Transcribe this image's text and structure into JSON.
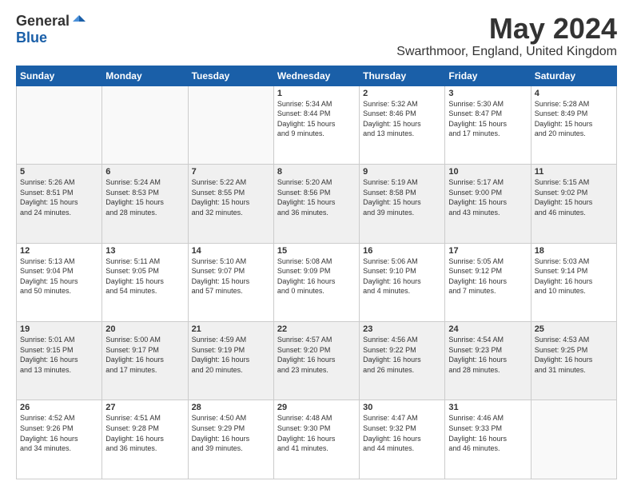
{
  "logo": {
    "general": "General",
    "blue": "Blue"
  },
  "header": {
    "month": "May 2024",
    "location": "Swarthmoor, England, United Kingdom"
  },
  "weekdays": [
    "Sunday",
    "Monday",
    "Tuesday",
    "Wednesday",
    "Thursday",
    "Friday",
    "Saturday"
  ],
  "weeks": [
    [
      {
        "day": "",
        "info": ""
      },
      {
        "day": "",
        "info": ""
      },
      {
        "day": "",
        "info": ""
      },
      {
        "day": "1",
        "info": "Sunrise: 5:34 AM\nSunset: 8:44 PM\nDaylight: 15 hours\nand 9 minutes."
      },
      {
        "day": "2",
        "info": "Sunrise: 5:32 AM\nSunset: 8:46 PM\nDaylight: 15 hours\nand 13 minutes."
      },
      {
        "day": "3",
        "info": "Sunrise: 5:30 AM\nSunset: 8:47 PM\nDaylight: 15 hours\nand 17 minutes."
      },
      {
        "day": "4",
        "info": "Sunrise: 5:28 AM\nSunset: 8:49 PM\nDaylight: 15 hours\nand 20 minutes."
      }
    ],
    [
      {
        "day": "5",
        "info": "Sunrise: 5:26 AM\nSunset: 8:51 PM\nDaylight: 15 hours\nand 24 minutes."
      },
      {
        "day": "6",
        "info": "Sunrise: 5:24 AM\nSunset: 8:53 PM\nDaylight: 15 hours\nand 28 minutes."
      },
      {
        "day": "7",
        "info": "Sunrise: 5:22 AM\nSunset: 8:55 PM\nDaylight: 15 hours\nand 32 minutes."
      },
      {
        "day": "8",
        "info": "Sunrise: 5:20 AM\nSunset: 8:56 PM\nDaylight: 15 hours\nand 36 minutes."
      },
      {
        "day": "9",
        "info": "Sunrise: 5:19 AM\nSunset: 8:58 PM\nDaylight: 15 hours\nand 39 minutes."
      },
      {
        "day": "10",
        "info": "Sunrise: 5:17 AM\nSunset: 9:00 PM\nDaylight: 15 hours\nand 43 minutes."
      },
      {
        "day": "11",
        "info": "Sunrise: 5:15 AM\nSunset: 9:02 PM\nDaylight: 15 hours\nand 46 minutes."
      }
    ],
    [
      {
        "day": "12",
        "info": "Sunrise: 5:13 AM\nSunset: 9:04 PM\nDaylight: 15 hours\nand 50 minutes."
      },
      {
        "day": "13",
        "info": "Sunrise: 5:11 AM\nSunset: 9:05 PM\nDaylight: 15 hours\nand 54 minutes."
      },
      {
        "day": "14",
        "info": "Sunrise: 5:10 AM\nSunset: 9:07 PM\nDaylight: 15 hours\nand 57 minutes."
      },
      {
        "day": "15",
        "info": "Sunrise: 5:08 AM\nSunset: 9:09 PM\nDaylight: 16 hours\nand 0 minutes."
      },
      {
        "day": "16",
        "info": "Sunrise: 5:06 AM\nSunset: 9:10 PM\nDaylight: 16 hours\nand 4 minutes."
      },
      {
        "day": "17",
        "info": "Sunrise: 5:05 AM\nSunset: 9:12 PM\nDaylight: 16 hours\nand 7 minutes."
      },
      {
        "day": "18",
        "info": "Sunrise: 5:03 AM\nSunset: 9:14 PM\nDaylight: 16 hours\nand 10 minutes."
      }
    ],
    [
      {
        "day": "19",
        "info": "Sunrise: 5:01 AM\nSunset: 9:15 PM\nDaylight: 16 hours\nand 13 minutes."
      },
      {
        "day": "20",
        "info": "Sunrise: 5:00 AM\nSunset: 9:17 PM\nDaylight: 16 hours\nand 17 minutes."
      },
      {
        "day": "21",
        "info": "Sunrise: 4:59 AM\nSunset: 9:19 PM\nDaylight: 16 hours\nand 20 minutes."
      },
      {
        "day": "22",
        "info": "Sunrise: 4:57 AM\nSunset: 9:20 PM\nDaylight: 16 hours\nand 23 minutes."
      },
      {
        "day": "23",
        "info": "Sunrise: 4:56 AM\nSunset: 9:22 PM\nDaylight: 16 hours\nand 26 minutes."
      },
      {
        "day": "24",
        "info": "Sunrise: 4:54 AM\nSunset: 9:23 PM\nDaylight: 16 hours\nand 28 minutes."
      },
      {
        "day": "25",
        "info": "Sunrise: 4:53 AM\nSunset: 9:25 PM\nDaylight: 16 hours\nand 31 minutes."
      }
    ],
    [
      {
        "day": "26",
        "info": "Sunrise: 4:52 AM\nSunset: 9:26 PM\nDaylight: 16 hours\nand 34 minutes."
      },
      {
        "day": "27",
        "info": "Sunrise: 4:51 AM\nSunset: 9:28 PM\nDaylight: 16 hours\nand 36 minutes."
      },
      {
        "day": "28",
        "info": "Sunrise: 4:50 AM\nSunset: 9:29 PM\nDaylight: 16 hours\nand 39 minutes."
      },
      {
        "day": "29",
        "info": "Sunrise: 4:48 AM\nSunset: 9:30 PM\nDaylight: 16 hours\nand 41 minutes."
      },
      {
        "day": "30",
        "info": "Sunrise: 4:47 AM\nSunset: 9:32 PM\nDaylight: 16 hours\nand 44 minutes."
      },
      {
        "day": "31",
        "info": "Sunrise: 4:46 AM\nSunset: 9:33 PM\nDaylight: 16 hours\nand 46 minutes."
      },
      {
        "day": "",
        "info": ""
      }
    ]
  ]
}
